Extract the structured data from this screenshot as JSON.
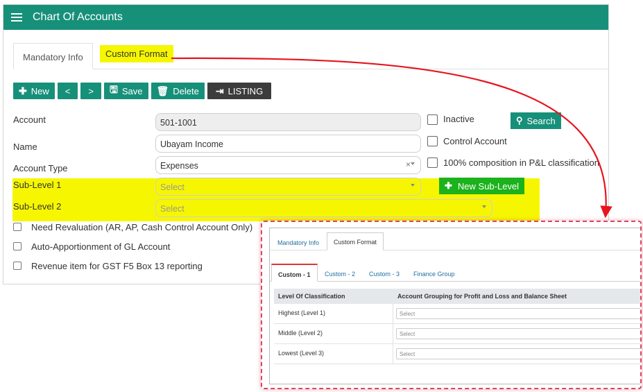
{
  "header": {
    "title": "Chart Of Accounts"
  },
  "tabs": [
    {
      "label": "Mandatory Info"
    },
    {
      "label": "Custom Format"
    }
  ],
  "toolbar": {
    "new": "New",
    "prev": "<",
    "next": ">",
    "save": "Save",
    "delete": "Delete",
    "listing": "LISTING"
  },
  "form": {
    "account": {
      "label": "Account",
      "value": "501-1001"
    },
    "name": {
      "label": "Name",
      "value": "Ubayam Income"
    },
    "account_type": {
      "label": "Account Type",
      "value": "Expenses"
    },
    "sub_level_1": {
      "label": "Sub-Level 1",
      "placeholder": "Select"
    },
    "sub_level_2": {
      "label": "Sub-Level 2",
      "placeholder": "Select"
    }
  },
  "options": {
    "inactive": "Inactive",
    "control_account": "Control Account",
    "pl_composition": "100% composition in P&L classification"
  },
  "buttons": {
    "search": "Search",
    "new_sub_level": "New Sub-Level"
  },
  "checkboxes": [
    {
      "label": "Need Revaluation (AR, AP, Cash Control Account Only)"
    },
    {
      "label": "Auto-Apportionment of GL Account"
    },
    {
      "label": "Revenue item for GST F5 Box 13 reporting"
    }
  ],
  "inset": {
    "tabs": [
      {
        "label": "Mandatory Info"
      },
      {
        "label": "Custom Format"
      }
    ],
    "subtabs": [
      {
        "label": "Custom - 1"
      },
      {
        "label": "Custom - 2"
      },
      {
        "label": "Custom - 3"
      },
      {
        "label": "Finance Group"
      }
    ],
    "columns": [
      "Level Of Classification",
      "Account Grouping for Profit and Loss and Balance Sheet"
    ],
    "rows": [
      {
        "level": "Highest (Level 1)",
        "placeholder": "Select"
      },
      {
        "level": "Middle (Level 2)",
        "placeholder": "Select"
      },
      {
        "level": "Lowest (Level 3)",
        "placeholder": "Select"
      }
    ]
  },
  "colors": {
    "brand": "#17907a",
    "highlight": "#f6f600",
    "arrow": "#e8141e",
    "inset_border": "#d8475f"
  }
}
